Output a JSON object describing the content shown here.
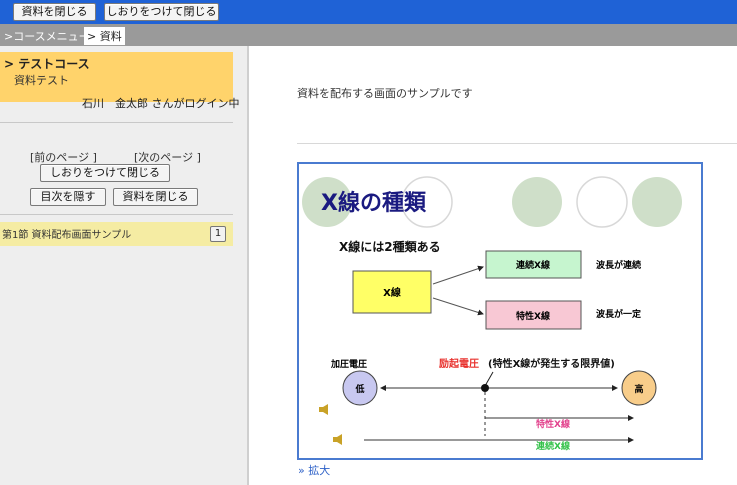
{
  "toolbar": {
    "close_material": "資料を閉じる",
    "bookmark_close": "しおりをつけて閉じる"
  },
  "breadcrumb": {
    "course_menu": ">コースメニュー",
    "current": "> 資料"
  },
  "sidebar": {
    "course_title": "> テストコース",
    "course_subtitle": "資料テスト",
    "login_text": "石川　金太郎  さんがログイン中",
    "prev_page": "[前のページ ]",
    "next_page": "[次のページ ]",
    "bookmark_close": "しおりをつけて閉じる",
    "hide_toc": "目次を隠す",
    "close_material": "資料を閉じる",
    "section_label": "第1節 資料配布画面サンプル",
    "section_page": "1"
  },
  "main": {
    "description": "資料を配布する画面のサンプルです",
    "zoom_link": "» 拡大"
  },
  "slide": {
    "title": "X線の種類",
    "subtitle": "X線には2種類ある",
    "xray_box": "X線",
    "continuous_box": "連続X線",
    "continuous_note": "波長が連続",
    "characteristic_box": "特性X線",
    "characteristic_note": "波長が一定",
    "voltage_label": "加圧電圧",
    "excitation_red": "励起電圧",
    "excitation_black": "(特性X線が発生する限界値)",
    "low": "低",
    "high": "高",
    "char_line_label": "特性X線",
    "cont_line_label": "連続X線",
    "colors": {
      "title_blue": "#1a1a80",
      "yellow": "#ffff66",
      "mint": "#c6f5cf",
      "pink": "#f8c8d4",
      "low_fill": "#c8c8f0",
      "high_fill": "#f8cd8a",
      "deco_green": "#cfdfc9",
      "red": "#e8302c",
      "pink_text": "#e2418c",
      "green_text": "#34c24a"
    }
  }
}
